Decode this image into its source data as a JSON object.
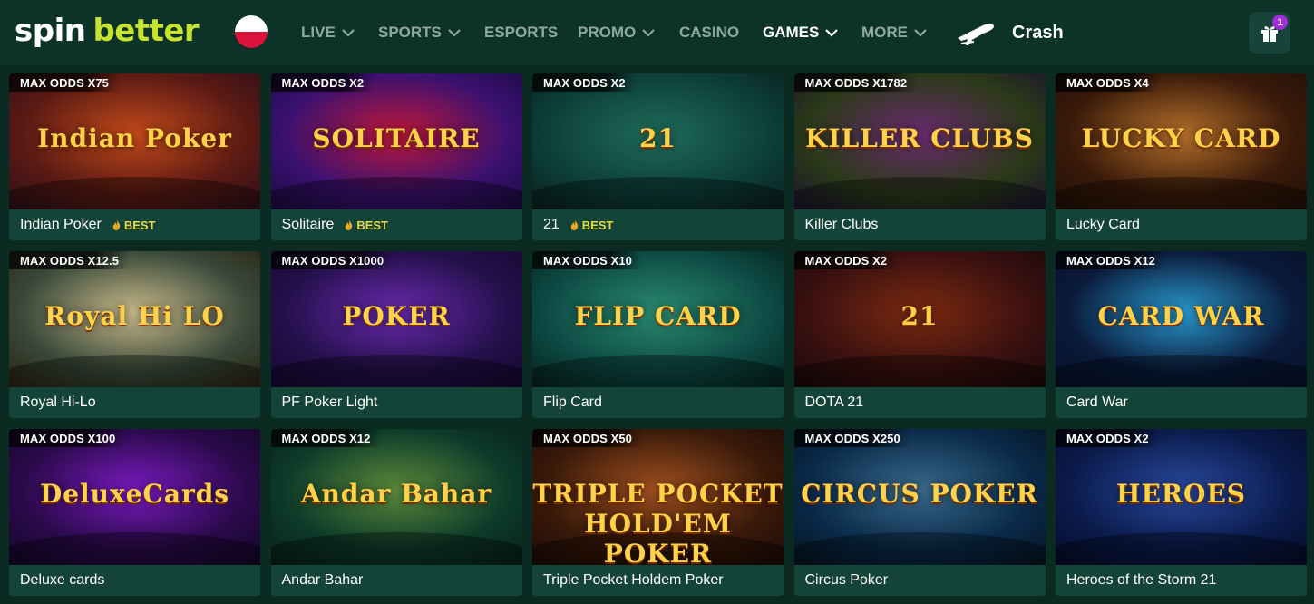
{
  "header": {
    "logo_word1": "spin",
    "logo_word2": "better",
    "nav": [
      {
        "label": "LIVE",
        "dropdown": true,
        "active": false
      },
      {
        "label": "SPORTS",
        "dropdown": true,
        "active": false
      },
      {
        "label": "ESPORTS",
        "dropdown": false,
        "active": false
      },
      {
        "label": "PROMO",
        "dropdown": true,
        "active": false
      },
      {
        "label": "CASINO",
        "dropdown": false,
        "active": false
      },
      {
        "label": "GAMES",
        "dropdown": true,
        "active": true
      },
      {
        "label": "MORE",
        "dropdown": true,
        "active": false
      }
    ],
    "crash_label": "Crash",
    "gift_count": "1"
  },
  "colors": {
    "background": "#0a2a22",
    "header": "#0d3329",
    "card_footer": "#144437",
    "accent_logo": "#c6e330",
    "badge": "#a02dd6",
    "best": "#e6d94a"
  },
  "games": [
    {
      "odds": "MAX ODDS X75",
      "name": "Indian Poker",
      "best": "BEST",
      "art": "Indian Poker"
    },
    {
      "odds": "MAX ODDS X2",
      "name": "Solitaire",
      "best": "BEST",
      "art": "SOLITAIRE"
    },
    {
      "odds": "MAX ODDS X2",
      "name": "21",
      "best": "BEST",
      "art": "21"
    },
    {
      "odds": "MAX ODDS X1782",
      "name": "Killer Clubs",
      "best": "",
      "art": "KILLER CLUBS"
    },
    {
      "odds": "MAX ODDS X4",
      "name": "Lucky Card",
      "best": "",
      "art": "LUCKY CARD"
    },
    {
      "odds": "MAX ODDS X12.5",
      "name": "Royal Hi-Lo",
      "best": "",
      "art": "Royal Hi LO"
    },
    {
      "odds": "MAX ODDS X1000",
      "name": "PF Poker Light",
      "best": "",
      "art": "POKER"
    },
    {
      "odds": "MAX ODDS X10",
      "name": "Flip Card",
      "best": "",
      "art": "FLIP CARD"
    },
    {
      "odds": "MAX ODDS X2",
      "name": "DOTA 21",
      "best": "",
      "art": "21"
    },
    {
      "odds": "MAX ODDS X12",
      "name": "Card War",
      "best": "",
      "art": "CARD WAR"
    },
    {
      "odds": "MAX ODDS X100",
      "name": "Deluxe cards",
      "best": "",
      "art": "DeluxeCards"
    },
    {
      "odds": "MAX ODDS X12",
      "name": "Andar Bahar",
      "best": "",
      "art": "Andar Bahar"
    },
    {
      "odds": "MAX ODDS X50",
      "name": "Triple Pocket Holdem Poker",
      "best": "",
      "art": "TRIPLE POCKET HOLD'EM POKER"
    },
    {
      "odds": "MAX ODDS X250",
      "name": "Circus Poker",
      "best": "",
      "art": "CIRCUS POKER"
    },
    {
      "odds": "MAX ODDS X2",
      "name": "Heroes of the Storm 21",
      "best": "",
      "art": "HEROES"
    }
  ]
}
